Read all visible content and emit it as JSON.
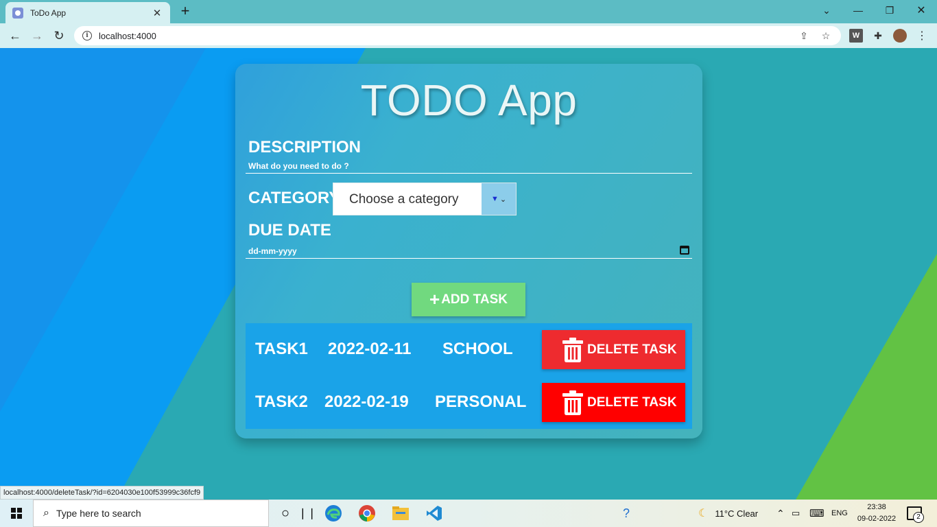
{
  "browser": {
    "tab_title": "ToDo App",
    "url": "localhost:4000",
    "status_url": "localhost:4000/deleteTask/?id=6204030e100f53999c36fcf9"
  },
  "app": {
    "title": "TODO App",
    "description_label": "DESCRIPTION",
    "description_placeholder": "What do you need to do ?",
    "category_label": "CATEGORY",
    "category_placeholder": "Choose a category",
    "due_date_label": "DUE DATE",
    "due_date_placeholder": "dd-mm-yyyy",
    "add_button": "ADD TASK",
    "delete_button": "DELETE TASK",
    "tasks": [
      {
        "name": "TASK1",
        "date": "2022-02-11",
        "category": "SCHOOL"
      },
      {
        "name": "TASK2",
        "date": "2022-02-19",
        "category": "PERSONAL"
      }
    ]
  },
  "taskbar": {
    "search_placeholder": "Type here to search",
    "weather": "11°C  Clear",
    "language": "ENG",
    "time": "23:38",
    "date": "09-02-2022",
    "notification_count": "2"
  },
  "colors": {
    "card_gradient_start": "#2fa0dc",
    "card_gradient_end": "#44b3bc",
    "add_button": "#71d97f",
    "delete_button_1": "#ee2b2f",
    "delete_button_2": "#ff0000",
    "task_list": "#1aa3e8",
    "background": "#2aa9b3",
    "background_left": "#0a9cf2",
    "background_right": "#62c244"
  }
}
